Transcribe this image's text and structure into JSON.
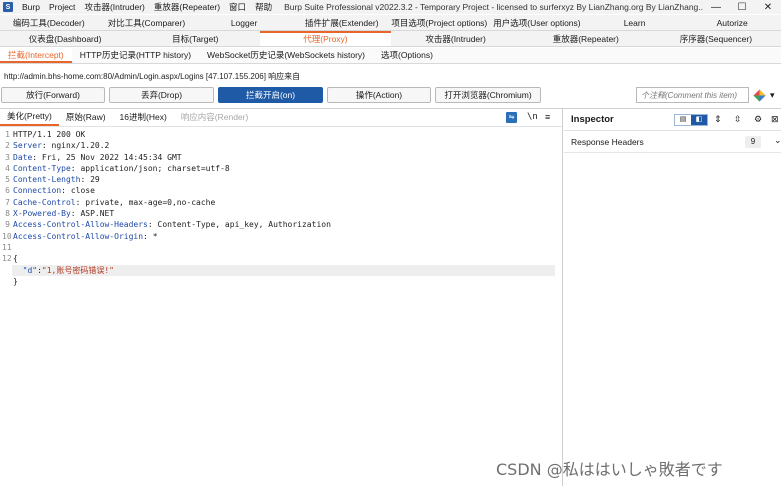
{
  "titlebar": {
    "logo": "S",
    "menu": [
      "Burp",
      "Project",
      "攻击器(Intruder)",
      "重放器(Repeater)",
      "窗口",
      "帮助"
    ],
    "title": "Burp Suite Professional v2022.3.2 - Temporary Project - licensed to surferxyz By LianZhang.org By LianZhang...",
    "minimize": "—",
    "maximize": "☐",
    "close": "✕"
  },
  "tabs_row1": [
    "编码工具(Decoder)",
    "对比工具(Comparer)",
    "Logger",
    "插件扩展(Extender)",
    "项目选项(Project options)",
    "用户选项(User options)",
    "Learn",
    "Autorize"
  ],
  "tabs_row2": [
    "仪表盘(Dashboard)",
    "目标(Target)",
    "代理(Proxy)",
    "攻击器(Intruder)",
    "重放器(Repeater)",
    "序序器(Sequencer)"
  ],
  "proxy_subtabs": [
    "拦截(Intercept)",
    "HTTP历史记录(HTTP history)",
    "WebSocket历史记录(WebSockets history)",
    "选项(Options)"
  ],
  "request_info": "http://admin.bhs-home.com:80/Admin/Login.aspx/Logins  [47.107.155.206] 响应来自",
  "actions": {
    "forward": "放行(Forward)",
    "drop": "丢弃(Drop)",
    "intercept": "拦截开启(on)",
    "action": "操作(Action)",
    "browser": "打开浏览器(Chromium)",
    "comment_placeholder": "个注释(Comment this item)"
  },
  "editor": {
    "tabs": [
      "美化(Pretty)",
      "原始(Raw)",
      "16进制(Hex)",
      "响应内容(Render)"
    ],
    "tool_wrap": "\\n",
    "tool_menu": "≡",
    "lines": [
      {
        "n": "1",
        "name": "",
        "sep": "",
        "val": "HTTP/1.1 200 OK"
      },
      {
        "n": "2",
        "name": "Server",
        "sep": ": ",
        "val": "nginx/1.20.2"
      },
      {
        "n": "3",
        "name": "Date",
        "sep": ": ",
        "val": "Fri, 25 Nov 2022 14:45:34 GMT"
      },
      {
        "n": "4",
        "name": "Content-Type",
        "sep": ": ",
        "val": "application/json; charset=utf-8"
      },
      {
        "n": "5",
        "name": "Content-Length",
        "sep": ": ",
        "val": "29"
      },
      {
        "n": "6",
        "name": "Connection",
        "sep": ": ",
        "val": "close"
      },
      {
        "n": "7",
        "name": "Cache-Control",
        "sep": ": ",
        "val": "private, max-age=0,no-cache"
      },
      {
        "n": "8",
        "name": "X-Powered-By",
        "sep": ": ",
        "val": "ASP.NET"
      },
      {
        "n": "9",
        "name": "Access-Control-Allow-Headers",
        "sep": ": ",
        "val": "Content-Type, api_key, Authorization"
      },
      {
        "n": "10",
        "name": "Access-Control-Allow-Origin",
        "sep": ": ",
        "val": "*"
      },
      {
        "n": "11",
        "name": "",
        "sep": "",
        "val": ""
      },
      {
        "n": "12",
        "name": "",
        "sep": "",
        "val": "{"
      }
    ],
    "json_key": "\"d\"",
    "json_colon": ":",
    "json_value": "\"1,账号密码错误!\"",
    "json_close": "}"
  },
  "inspector": {
    "title": "Inspector",
    "section": "Response Headers",
    "count": "9"
  },
  "watermark": "CSDN @私ははいしゃ敗者です"
}
